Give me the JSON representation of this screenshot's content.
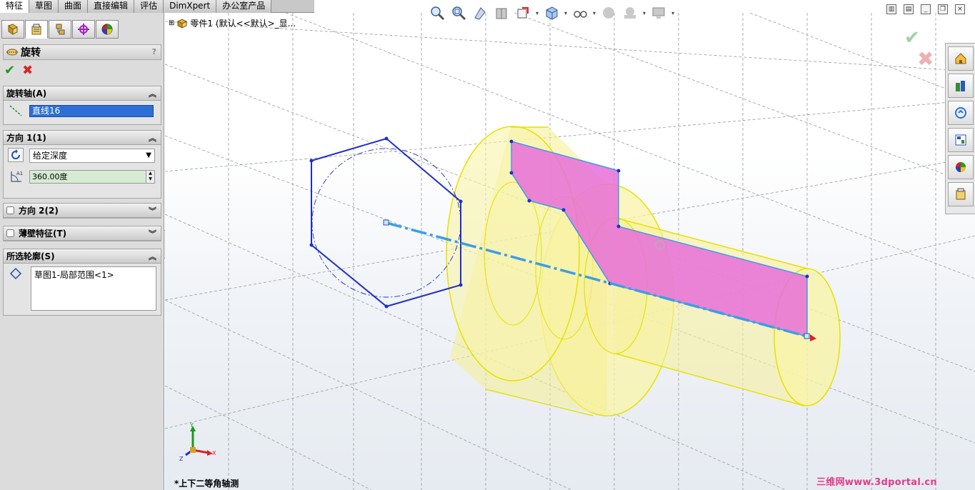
{
  "tabs": [
    "特征",
    "草图",
    "曲面",
    "直接编辑",
    "评估",
    "DimXpert",
    "办公室产品"
  ],
  "active_tab": 0,
  "property_manager": {
    "tab_icons": [
      "feature-manager-icon",
      "property-manager-icon",
      "configuration-manager-icon",
      "dimxpert-manager-icon",
      "display-manager-icon"
    ],
    "title": "旋转",
    "help": "?",
    "ok_symbol": "✔",
    "cancel_symbol": "✖",
    "axis_group": {
      "title": "旋转轴(A)",
      "value": "直线16"
    },
    "direction1_group": {
      "title": "方向 1(1)",
      "end_condition": "给定深度",
      "angle": "360.00度"
    },
    "direction2_group": {
      "title": "方向 2(2)"
    },
    "thin_feature_group": {
      "title": "薄壁特征(T)"
    },
    "selected_contours_group": {
      "title": "所选轮廓(S)",
      "items": [
        "草图1-局部范围<1>"
      ]
    }
  },
  "feature_tree": {
    "label": "零件1  (默认<<默认>_显..."
  },
  "heads_up_toolbar": [
    "zoom-to-fit-icon",
    "zoom-to-area-icon",
    "previous-view-icon",
    "section-view-icon",
    "view-orientation-icon",
    "display-style-icon",
    "hide-show-items-icon",
    "edit-appearance-icon",
    "apply-scene-icon",
    "view-settings-icon"
  ],
  "task_pane": [
    "solidworks-resources-icon",
    "design-library-icon",
    "file-explorer-icon",
    "view-palette-icon",
    "appearances-scenes-icon",
    "custom-properties-icon"
  ],
  "viewport": {
    "view_orientation_label": "*上下二等角轴测",
    "triad": {
      "x": "X",
      "y": "Y",
      "z": "Z"
    }
  },
  "watermark": "三维网www.3dportal.cn",
  "colors": {
    "sketch_blue": "#1f2fc8",
    "axis_blue": "#3a9ee8",
    "profile_fill": "#e86fd8",
    "body_yellow": "#f7f29a",
    "body_edge": "#e8e400"
  }
}
